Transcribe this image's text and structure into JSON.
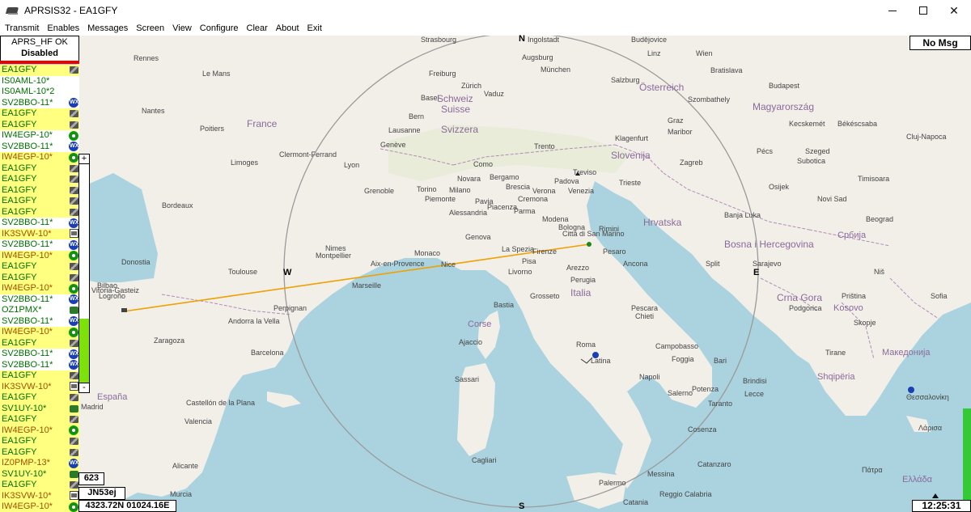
{
  "window": {
    "title": "APRSIS32 - EA1GFY",
    "minimize_icon": "minimize-icon",
    "maximize_icon": "maximize-icon",
    "close_icon": "close-icon"
  },
  "menu": [
    "Transmit",
    "Enables",
    "Messages",
    "Screen",
    "View",
    "Configure",
    "Clear",
    "About",
    "Exit"
  ],
  "status": {
    "line1": "APRS_HF OK",
    "line2": "Disabled"
  },
  "stations": [
    {
      "call": "EA1GFY",
      "bg": "#ffff80",
      "color": "#007000",
      "icon": "laptop"
    },
    {
      "call": "IS0AML-10*",
      "bg": "#ffffff",
      "color": "#007000",
      "icon": ""
    },
    {
      "call": "IS0AML-10*2",
      "bg": "#ffffff",
      "color": "#007000",
      "icon": ""
    },
    {
      "call": "SV2BBO-11*",
      "bg": "#ffffff",
      "color": "#007000",
      "icon": "wx"
    },
    {
      "call": "EA1GFY",
      "bg": "#ffff80",
      "color": "#007000",
      "icon": "laptop"
    },
    {
      "call": "EA1GFY",
      "bg": "#ffff80",
      "color": "#007000",
      "icon": "laptop"
    },
    {
      "call": "IW4EGP-10*",
      "bg": "#ffffff",
      "color": "#007000",
      "icon": "digi"
    },
    {
      "call": "SV2BBO-11*",
      "bg": "#ffffff",
      "color": "#007000",
      "icon": "wx"
    },
    {
      "call": "IW4EGP-10*",
      "bg": "#ffff80",
      "color": "#a05000",
      "icon": "digi"
    },
    {
      "call": "EA1GFY",
      "bg": "#ffff80",
      "color": "#007000",
      "icon": "laptop"
    },
    {
      "call": "EA1GFY",
      "bg": "#ffff80",
      "color": "#007000",
      "icon": "laptop"
    },
    {
      "call": "EA1GFY",
      "bg": "#ffff80",
      "color": "#007000",
      "icon": "laptop"
    },
    {
      "call": "EA1GFY",
      "bg": "#ffff80",
      "color": "#007000",
      "icon": "laptop"
    },
    {
      "call": "EA1GFY",
      "bg": "#ffff80",
      "color": "#007000",
      "icon": "laptop"
    },
    {
      "call": "SV2BBO-11*",
      "bg": "#ffffff",
      "color": "#007000",
      "icon": "wx"
    },
    {
      "call": "IK3SVW-10*",
      "bg": "#ffff80",
      "color": "#a05000",
      "icon": "house"
    },
    {
      "call": "SV2BBO-11*",
      "bg": "#ffffff",
      "color": "#007000",
      "icon": "wx"
    },
    {
      "call": "IW4EGP-10*",
      "bg": "#ffff80",
      "color": "#a05000",
      "icon": "digi"
    },
    {
      "call": "EA1GFY",
      "bg": "#ffff80",
      "color": "#007000",
      "icon": "laptop"
    },
    {
      "call": "EA1GFY",
      "bg": "#ffff80",
      "color": "#007000",
      "icon": "laptop"
    },
    {
      "call": "IW4EGP-10*",
      "bg": "#ffff80",
      "color": "#a05000",
      "icon": "digi"
    },
    {
      "call": "SV2BBO-11*",
      "bg": "#ffffff",
      "color": "#007000",
      "icon": "wx"
    },
    {
      "call": "OZ1PMX*",
      "bg": "#ffffff",
      "color": "#007000",
      "icon": "car"
    },
    {
      "call": "SV2BBO-11*",
      "bg": "#ffffff",
      "color": "#007000",
      "icon": "wx"
    },
    {
      "call": "IW4EGP-10*",
      "bg": "#ffff80",
      "color": "#a05000",
      "icon": "digi"
    },
    {
      "call": "EA1GFY",
      "bg": "#ffff80",
      "color": "#007000",
      "icon": "laptop"
    },
    {
      "call": "SV2BBO-11*",
      "bg": "#ffffff",
      "color": "#007000",
      "icon": "wx"
    },
    {
      "call": "SV2BBO-11*",
      "bg": "#ffffff",
      "color": "#007000",
      "icon": "wx"
    },
    {
      "call": "EA1GFY",
      "bg": "#ffff80",
      "color": "#007000",
      "icon": "laptop"
    },
    {
      "call": "IK3SVW-10*",
      "bg": "#ffff80",
      "color": "#a05000",
      "icon": "house"
    },
    {
      "call": "EA1GFY",
      "bg": "#ffff80",
      "color": "#007000",
      "icon": "laptop"
    },
    {
      "call": "SV1UY-10*",
      "bg": "#ffff80",
      "color": "#007000",
      "icon": "car"
    },
    {
      "call": "EA1GFY",
      "bg": "#ffff80",
      "color": "#007000",
      "icon": "laptop"
    },
    {
      "call": "IW4EGP-10*",
      "bg": "#ffff80",
      "color": "#a05000",
      "icon": "digi"
    },
    {
      "call": "EA1GFY",
      "bg": "#ffff80",
      "color": "#007000",
      "icon": "laptop"
    },
    {
      "call": "EA1GFY",
      "bg": "#ffff80",
      "color": "#007000",
      "icon": "laptop"
    },
    {
      "call": "IZ0PMP-13*",
      "bg": "#ffff80",
      "color": "#a05000",
      "icon": "wx"
    },
    {
      "call": "SV1UY-10*",
      "bg": "#ffff80",
      "color": "#007000",
      "icon": "car"
    },
    {
      "call": "EA1GFY",
      "bg": "#ffff80",
      "color": "#007000",
      "icon": "laptop"
    },
    {
      "call": "IK3SVW-10*",
      "bg": "#ffff80",
      "color": "#a05000",
      "icon": "house"
    },
    {
      "call": "IW4EGP-10*",
      "bg": "#ffff80",
      "color": "#a05000",
      "icon": "digi"
    }
  ],
  "scroll": {
    "plus": "+",
    "minus": "-",
    "fill_fraction": 0.27
  },
  "no_msg": "No Msg",
  "bottom": {
    "count": "623",
    "grid": "JN53ej",
    "coords": "4323.72N 01024.16E",
    "time": "12:25:31"
  },
  "compass": {
    "n": "N",
    "s": "S",
    "e": "E",
    "w": "W"
  },
  "map_labels": [
    "Rennes",
    "Le Mans",
    "Nantes",
    "Poitiers",
    "France",
    "Limoges",
    "Bordeaux",
    "Clermont-Ferrand",
    "Lyon",
    "Grenoble",
    "Toulouse",
    "Montpellier",
    "Marseille",
    "Nimes",
    "Aix-en-Provence",
    "Monaco",
    "Nice",
    "Perpignan",
    "Andorra la Vella",
    "Barcelona",
    "Zaragoza",
    "Bilbao",
    "Vitoria-Gasteiz",
    "Logroño",
    "Donostia",
    "Castellón de la Plana",
    "Valencia",
    "Alicante",
    "Murcia",
    "España",
    "Madrid",
    "Strasbourg",
    "Freiburg",
    "Basel",
    "Bern",
    "Schweiz",
    "Suisse",
    "Svizzera",
    "Lausanne",
    "Genève",
    "Zürich",
    "Vaduz",
    "Ingolstadt",
    "Augsburg",
    "München",
    "Salzburg",
    "Budějovice",
    "Wien",
    "Linz",
    "Bratislava",
    "Österreich",
    "Graz",
    "Klagenfurt",
    "Maribor",
    "Slovenija",
    "Zagreb",
    "Hrvatska",
    "Szombathely",
    "Budapest",
    "Magyarország",
    "Kecskemét",
    "Békéscsaba",
    "Pécs",
    "Szeged",
    "Subotica",
    "Novi Sad",
    "Timisoara",
    "Cluj-Napoca",
    "Beograd",
    "Osijek",
    "Banja Luka",
    "Bosna i Hercegovina",
    "Sarajevo",
    "Split",
    "Crna Gora",
    "Podgorica",
    "Kosovo",
    "Priština",
    "Skopje",
    "Македонија",
    "Tirane",
    "Shqipëria",
    "Sofia",
    "Србија",
    "Niš",
    "Trento",
    "Treviso",
    "Padova",
    "Venezia",
    "Trieste",
    "Verona",
    "Brescia",
    "Milano",
    "Como",
    "Bergamo",
    "Torino",
    "Novara",
    "Piemonte",
    "Alessandria",
    "Pavia",
    "Cremona",
    "Piacenza",
    "Parma",
    "Modena",
    "Bologna",
    "Genova",
    "La Spezia",
    "Firenze",
    "Livorno",
    "Pisa",
    "Arezzo",
    "Perugia",
    "Rimini",
    "Pesaro",
    "Ancona",
    "Città di San Marino",
    "Grosseto",
    "Italia",
    "Roma",
    "Latina",
    "Pescara",
    "Chieti",
    "Campobasso",
    "Foggia",
    "Bari",
    "Napoli",
    "Salerno",
    "Potenza",
    "Taranto",
    "Brindisi",
    "Lecce",
    "Cosenza",
    "Catanzaro",
    "Reggio Calabria",
    "Messina",
    "Palermo",
    "Catania",
    "Sassari",
    "Cagliari",
    "Corse",
    "Ajaccio",
    "Bastia",
    "Ελλάδα",
    "Λάρισα",
    "Πάτρα",
    "Θεσσαλονίκη"
  ],
  "colors": {
    "yellow_row": "#ffff80",
    "callsign_green": "#007000",
    "callsign_brown": "#a05000",
    "scroll_fill": "#7ee10b",
    "status_red": "#e00000",
    "track_line": "#f0a000",
    "sea": "#aad3df",
    "land": "#f2efe9"
  }
}
